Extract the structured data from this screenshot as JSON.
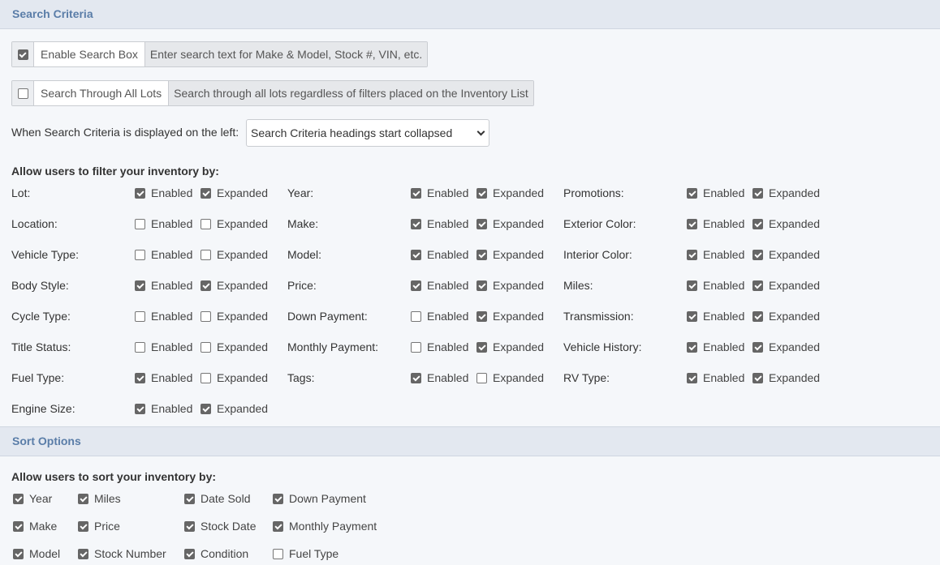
{
  "search_section": {
    "title": "Search Criteria",
    "enable_search_box": {
      "checked": true,
      "label": "Enable Search Box",
      "description": "Enter search text for Make & Model, Stock #, VIN, etc."
    },
    "search_all_lots": {
      "checked": false,
      "label": "Search Through All Lots",
      "description": "Search through all lots regardless of filters placed on the Inventory List"
    },
    "display_label": "When Search Criteria is displayed on the left:",
    "display_select_value": "Search Criteria headings start collapsed",
    "filter_heading": "Allow users to filter your inventory by:",
    "enabled_label": "Enabled",
    "expanded_label": "Expanded",
    "filter_columns": [
      [
        {
          "label": "Lot:",
          "enabled": true,
          "expanded": true
        },
        {
          "label": "Location:",
          "enabled": false,
          "expanded": false
        },
        {
          "label": "Vehicle Type:",
          "enabled": false,
          "expanded": false
        },
        {
          "label": "Body Style:",
          "enabled": true,
          "expanded": true
        },
        {
          "label": "Cycle Type:",
          "enabled": false,
          "expanded": false
        },
        {
          "label": "Title Status:",
          "enabled": false,
          "expanded": false
        },
        {
          "label": "Fuel Type:",
          "enabled": true,
          "expanded": false
        },
        {
          "label": "Engine Size:",
          "enabled": true,
          "expanded": true
        }
      ],
      [
        {
          "label": "Year:",
          "enabled": true,
          "expanded": true
        },
        {
          "label": "Make:",
          "enabled": true,
          "expanded": true
        },
        {
          "label": "Model:",
          "enabled": true,
          "expanded": true
        },
        {
          "label": "Price:",
          "enabled": true,
          "expanded": true
        },
        {
          "label": "Down Payment:",
          "enabled": false,
          "expanded": true
        },
        {
          "label": "Monthly Payment:",
          "enabled": false,
          "expanded": true
        },
        {
          "label": "Tags:",
          "enabled": true,
          "expanded": false
        }
      ],
      [
        {
          "label": "Promotions:",
          "enabled": true,
          "expanded": true
        },
        {
          "label": "Exterior Color:",
          "enabled": true,
          "expanded": true
        },
        {
          "label": "Interior Color:",
          "enabled": true,
          "expanded": true
        },
        {
          "label": "Miles:",
          "enabled": true,
          "expanded": true
        },
        {
          "label": "Transmission:",
          "enabled": true,
          "expanded": true
        },
        {
          "label": "Vehicle History:",
          "enabled": true,
          "expanded": true
        },
        {
          "label": "RV Type:",
          "enabled": true,
          "expanded": true
        }
      ]
    ]
  },
  "sort_section": {
    "title": "Sort Options",
    "heading": "Allow users to sort your inventory by:",
    "columns": [
      [
        {
          "label": "Year",
          "checked": true
        },
        {
          "label": "Make",
          "checked": true
        },
        {
          "label": "Model",
          "checked": true
        }
      ],
      [
        {
          "label": "Miles",
          "checked": true
        },
        {
          "label": "Price",
          "checked": true
        },
        {
          "label": "Stock Number",
          "checked": true
        }
      ],
      [
        {
          "label": "Date Sold",
          "checked": true
        },
        {
          "label": "Stock Date",
          "checked": true
        },
        {
          "label": "Condition",
          "checked": true
        }
      ],
      [
        {
          "label": "Down Payment",
          "checked": true
        },
        {
          "label": "Monthly Payment",
          "checked": true
        },
        {
          "label": "Fuel Type",
          "checked": false
        }
      ]
    ]
  }
}
